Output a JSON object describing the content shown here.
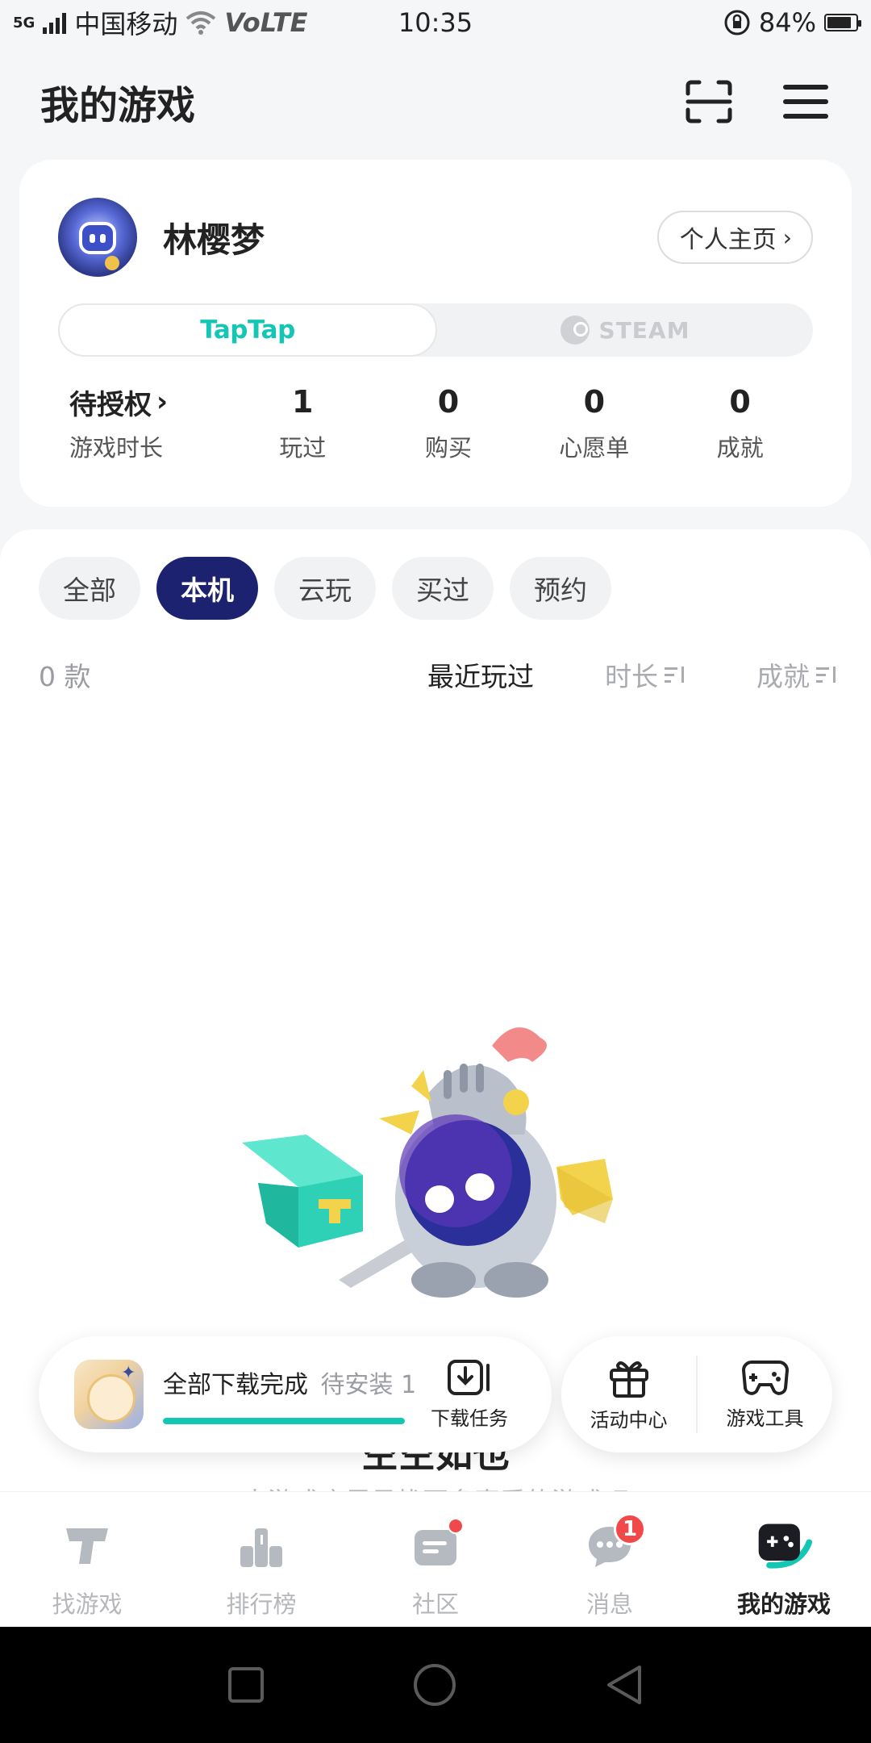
{
  "status_bar": {
    "network": "5G",
    "carrier": "中国移动",
    "volte": "VoLTE",
    "time": "10:35",
    "battery": "84%",
    "battery_level": 0.84
  },
  "header": {
    "title": "我的游戏",
    "scan_icon": "scan-icon",
    "menu_icon": "hamburger-menu-icon"
  },
  "profile": {
    "username": "林樱梦",
    "homepage_label": "个人主页",
    "platform_tabs": [
      {
        "label": "TapTap",
        "active": true
      },
      {
        "label": "STEAM",
        "active": false
      }
    ],
    "stats": [
      {
        "value": "待授权",
        "label": "游戏时长"
      },
      {
        "value": "1",
        "label": "玩过"
      },
      {
        "value": "0",
        "label": "购买"
      },
      {
        "value": "0",
        "label": "心愿单"
      },
      {
        "value": "0",
        "label": "成就"
      }
    ]
  },
  "filters": {
    "tabs": [
      "全部",
      "本机",
      "云玩",
      "买过",
      "预约"
    ],
    "active_index": 1
  },
  "sort_row": {
    "count": "0 款",
    "options": [
      "最近玩过",
      "时长",
      "成就"
    ],
    "active_index": 0
  },
  "empty_state": {
    "title": "空空如也",
    "subtitle": "去游戏库里寻找更多喜爱的游戏吧"
  },
  "download_bar": {
    "status": "全部下载完成",
    "pending": "待安装 1",
    "progress": 1.0,
    "task_label": "下载任务",
    "app_badge": "miHoYo"
  },
  "tools": {
    "activity_label": "活动中心",
    "game_tools_label": "游戏工具"
  },
  "bottom_nav": {
    "items": [
      {
        "label": "找游戏",
        "icon": "taptap-t-icon"
      },
      {
        "label": "排行榜",
        "icon": "ranking-podium-icon"
      },
      {
        "label": "社区",
        "icon": "community-card-icon"
      },
      {
        "label": "消息",
        "icon": "message-bubble-icon",
        "badge": "1"
      },
      {
        "label": "我的游戏",
        "icon": "gamepad-icon",
        "active": true
      }
    ]
  },
  "colors": {
    "accent": "#14c6b4",
    "active_tab": "#1c2270",
    "badge": "#f1484a"
  }
}
